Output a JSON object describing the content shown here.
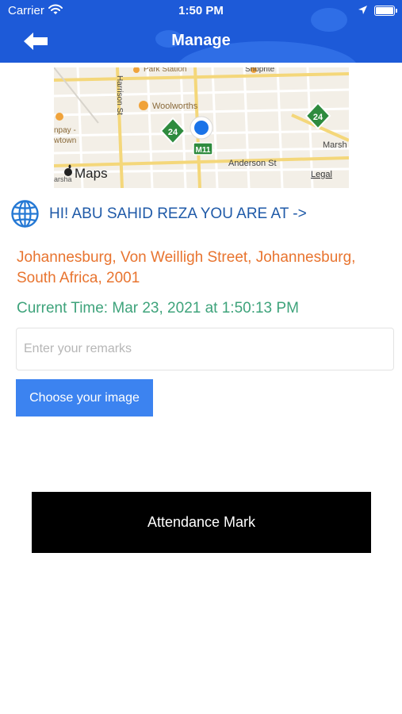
{
  "status_bar": {
    "carrier": "Carrier",
    "time": "1:50 PM"
  },
  "header": {
    "title": "Manage",
    "back_icon": "arrow-left-icon",
    "background_color": "#1d5ad8"
  },
  "map": {
    "streets": {
      "harrison": "Harrison St",
      "park_station": "Park Station",
      "shoprite": "Shoprite",
      "woolworths": "Woolworths",
      "marshall": "Marsh",
      "anderson": "Anderson St",
      "left_partial_1": "npay -",
      "left_partial_2": "wtown",
      "bottom_left_partial": "arsha"
    },
    "route_shields": [
      "24",
      "24"
    ],
    "route_marker": "M11",
    "attribution_brand": "Maps",
    "legal_link": "Legal"
  },
  "greeting": "HI! ABU SAHID REZA YOU ARE AT ->",
  "location": {
    "address": "Johannesburg, Von Weilligh Street, Johannesburg, South Africa, 2001",
    "current_time": "Current Time: Mar 23, 2021 at 1:50:13 PM"
  },
  "remarks": {
    "placeholder": "Enter your remarks",
    "value": ""
  },
  "buttons": {
    "choose_image": "Choose your image",
    "attendance": "Attendance Mark"
  },
  "colors": {
    "greeting": "#1f5aa8",
    "address": "#e8742f",
    "time": "#3ea37b",
    "choose_image_bg": "#3c83f0",
    "attendance_bg": "#000000"
  }
}
